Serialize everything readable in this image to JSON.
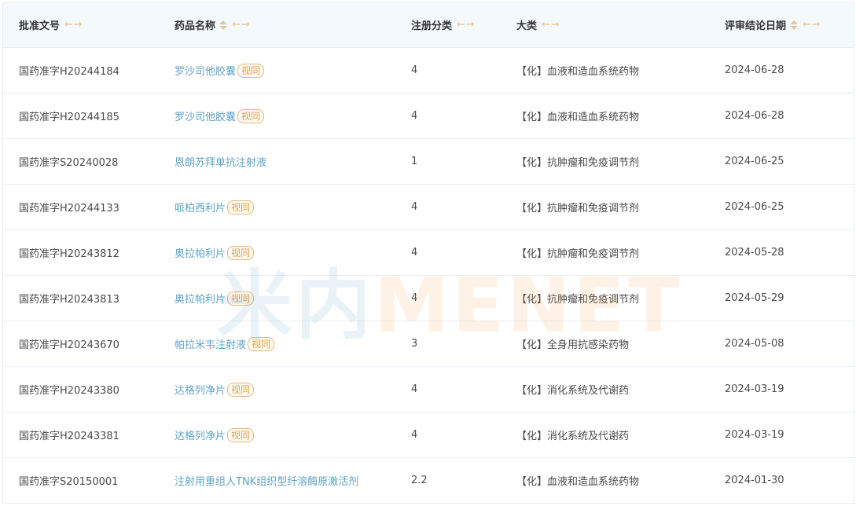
{
  "header": {
    "col1": "批准文号",
    "col2": "药品名称",
    "col3": "注册分类",
    "col4": "大类",
    "col5": "评审结论日期",
    "arrows": "←→"
  },
  "rows": [
    {
      "approval": "国药准字H20244184",
      "drug": "罗沙司他胶囊",
      "badge": "视同",
      "category": "4",
      "class": "【化】血液和造血系统药物",
      "date": "2024-06-28"
    },
    {
      "approval": "国药准字H20244185",
      "drug": "罗沙司他胶囊",
      "badge": "视同",
      "category": "4",
      "class": "【化】血液和造血系统药物",
      "date": "2024-06-28"
    },
    {
      "approval": "国药准字S20240028",
      "drug": "恩朗苏拜单抗注射液",
      "badge": "",
      "category": "1",
      "class": "【化】抗肿瘤和免疫调节剂",
      "date": "2024-06-25"
    },
    {
      "approval": "国药准字H20244133",
      "drug": "哌柏西利片",
      "badge": "视同",
      "category": "4",
      "class": "【化】抗肿瘤和免疫调节剂",
      "date": "2024-06-25"
    },
    {
      "approval": "国药准字H20243812",
      "drug": "奥拉帕利片",
      "badge": "视同",
      "category": "4",
      "class": "【化】抗肿瘤和免疫调节剂",
      "date": "2024-05-28"
    },
    {
      "approval": "国药准字H20243813",
      "drug": "奥拉帕利片",
      "badge": "视同",
      "category": "4",
      "class": "【化】抗肿瘤和免疫调节剂",
      "date": "2024-05-29"
    },
    {
      "approval": "国药准字H20243670",
      "drug": "帕拉米韦注射液",
      "badge": "视同",
      "category": "3",
      "class": "【化】全身用抗感染药物",
      "date": "2024-05-08"
    },
    {
      "approval": "国药准字H20243380",
      "drug": "达格列净片",
      "badge": "视同",
      "category": "4",
      "class": "【化】消化系统及代谢药",
      "date": "2024-03-19"
    },
    {
      "approval": "国药准字H20243381",
      "drug": "达格列净片",
      "badge": "视同",
      "category": "4",
      "class": "【化】消化系统及代谢药",
      "date": "2024-03-19"
    },
    {
      "approval": "国药准字S20150001",
      "drug": "注射用重组人TNK组织型纤溶酶原激活剂",
      "badge": "",
      "category": "2.2",
      "class": "【化】血液和造血系统药物",
      "date": "2024-01-30"
    }
  ],
  "watermark": {
    "cn": "米内",
    "en": "MENET"
  },
  "colors": {
    "link": "#5fa3c9",
    "badge": "#d9a24e",
    "header_bg": "#f4f9fd"
  }
}
